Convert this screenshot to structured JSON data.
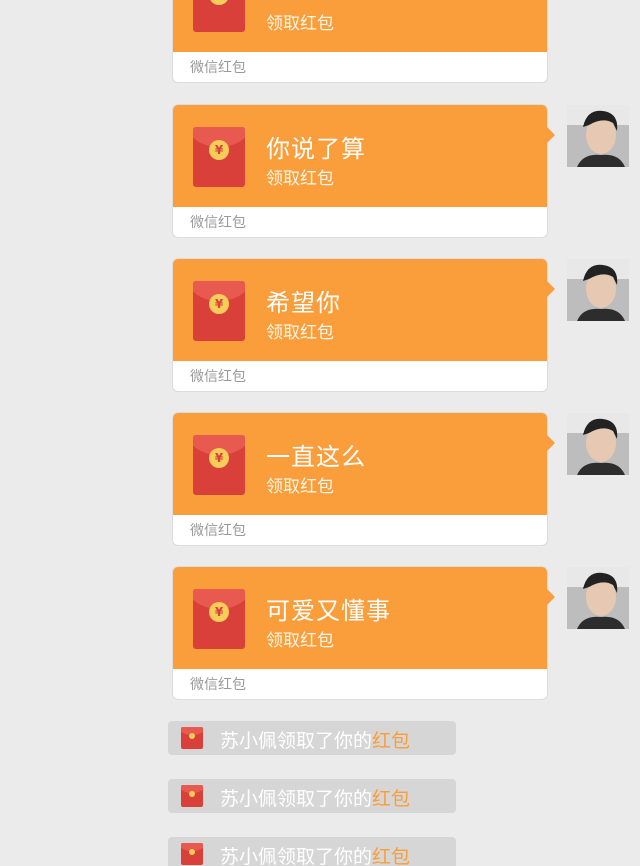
{
  "messages": [
    {
      "greeting": "",
      "receive_label": "领取红包",
      "footer_label": "微信红包"
    },
    {
      "greeting": "你说了算",
      "receive_label": "领取红包",
      "footer_label": "微信红包"
    },
    {
      "greeting": "希望你",
      "receive_label": "领取红包",
      "footer_label": "微信红包"
    },
    {
      "greeting": "一直这么",
      "receive_label": "领取红包",
      "footer_label": "微信红包"
    },
    {
      "greeting": "可爱又懂事",
      "receive_label": "领取红包",
      "footer_label": "微信红包"
    }
  ],
  "notices": [
    {
      "prefix": "苏小佩领取了你的",
      "highlight": "红包"
    },
    {
      "prefix": "苏小佩领取了你的",
      "highlight": "红包"
    },
    {
      "prefix": "苏小佩领取了你的",
      "highlight": "红包"
    }
  ],
  "colors": {
    "background": "#ebebeb",
    "red_packet_orange": "#fa9d3b",
    "envelope_red": "#d9403a",
    "coin_gold": "#f7cd5a",
    "notice_background": "#d6d6d6"
  },
  "icons": {
    "envelope": "red-envelope-icon",
    "coin": "yuan-coin-icon"
  }
}
